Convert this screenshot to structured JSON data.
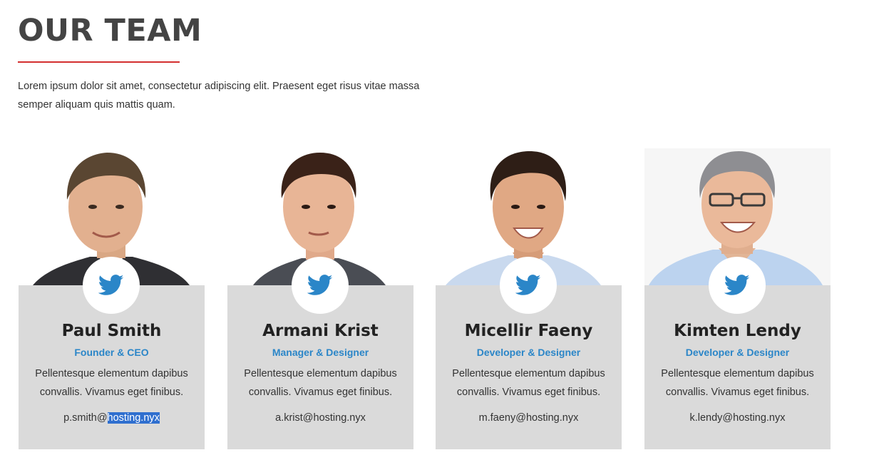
{
  "section": {
    "title": "OUR TEAM",
    "intro": "Lorem ipsum dolor sit amet, consectetur adipiscing elit. Praesent eget risus vitae massa semper aliquam quis mattis quam."
  },
  "colors": {
    "accent_red": "#d32f2f",
    "role_blue": "#2b86c8",
    "card_gray": "#dadada",
    "twitter_blue": "#2b86c8",
    "selection": "#2f6fcf"
  },
  "members": [
    {
      "name": "Paul Smith",
      "role": "Founder & CEO",
      "bio": "Pellentesque elementum dapibus convallis. Vivamus eget finibus.",
      "email_prefix": "p.smith@",
      "email_selected": "hosting.nyx",
      "icon": "twitter-icon"
    },
    {
      "name": "Armani Krist",
      "role": "Manager & Designer",
      "bio": "Pellentesque elementum dapibus convallis. Vivamus eget finibus.",
      "email": "a.krist@hosting.nyx",
      "icon": "twitter-icon"
    },
    {
      "name": "Micellir Faeny",
      "role": "Developer & Designer",
      "bio": "Pellentesque elementum dapibus convallis. Vivamus eget finibus.",
      "email": "m.faeny@hosting.nyx",
      "icon": "twitter-icon"
    },
    {
      "name": "Kimten Lendy",
      "role": "Developer & Designer",
      "bio": "Pellentesque elementum dapibus convallis. Vivamus eget finibus.",
      "email": "k.lendy@hosting.nyx",
      "icon": "twitter-icon"
    }
  ]
}
